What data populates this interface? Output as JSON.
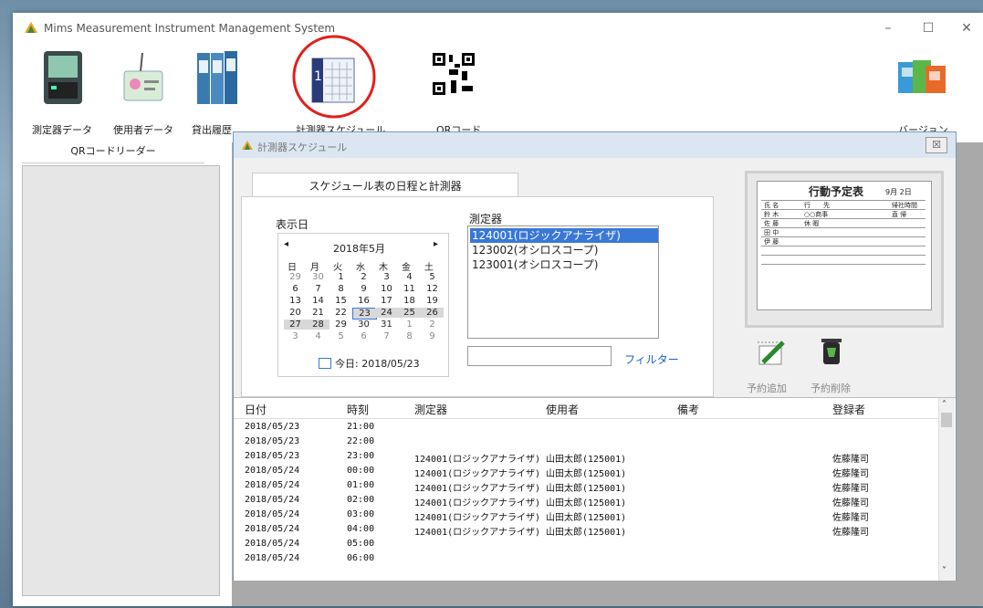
{
  "window": {
    "title": "Mims  Measurement Instrument Management System",
    "minimize": "–",
    "maximize": "☐",
    "close": "✕"
  },
  "toolbar": {
    "items": [
      {
        "label": "測定器データ"
      },
      {
        "label": "使用者データ"
      },
      {
        "label": "貸出履歴"
      },
      {
        "label": "計測器スケジュール"
      },
      {
        "label": "QRコード"
      },
      {
        "label": "バージョン"
      }
    ]
  },
  "left_panel": {
    "tab": "QRコードリーダー"
  },
  "dialog": {
    "title": "計測器スケジュール",
    "close": "☒",
    "tab": "スケジュール表の日程と計測器",
    "display_date_label": "表示日",
    "calendar": {
      "month": "2018年5月",
      "prev": "◂",
      "next": "▸",
      "weekdays": [
        "日",
        "月",
        "火",
        "水",
        "木",
        "金",
        "土"
      ],
      "weeks": [
        [
          "29",
          "30",
          "1",
          "2",
          "3",
          "4",
          "5"
        ],
        [
          "6",
          "7",
          "8",
          "9",
          "10",
          "11",
          "12"
        ],
        [
          "13",
          "14",
          "15",
          "16",
          "17",
          "18",
          "19"
        ],
        [
          "20",
          "21",
          "22",
          "23",
          "24",
          "25",
          "26"
        ],
        [
          "27",
          "28",
          "29",
          "30",
          "31",
          "1",
          "2"
        ],
        [
          "3",
          "4",
          "5",
          "6",
          "7",
          "8",
          "9"
        ]
      ],
      "today": "今日: 2018/05/23"
    },
    "instrument_label": "測定器",
    "instruments": [
      "124001(ロジックアナライザ)",
      "123002(オシロスコープ)",
      "123001(オシロスコープ)"
    ],
    "filter_label": "フィルター",
    "whiteboard": {
      "title": "行動予定表",
      "date": "9月 2日",
      "headers": [
        "氏 名",
        "行　　先",
        "帰社時間"
      ],
      "rows": [
        [
          "鈴 木",
          "○○商事",
          "直 帰"
        ],
        [
          "佐 藤",
          "休 暇",
          ""
        ],
        [
          "田 中",
          "",
          ""
        ],
        [
          "伊 藤",
          "",
          ""
        ]
      ]
    },
    "add_label": "予約追加",
    "delete_label": "予約削除",
    "grid": {
      "headers": [
        "日付",
        "時刻",
        "測定器",
        "使用者",
        "備考",
        "登録者"
      ],
      "rows": [
        [
          "2018/05/23",
          "21:00",
          "",
          "",
          "",
          ""
        ],
        [
          "2018/05/23",
          "22:00",
          "",
          "",
          "",
          ""
        ],
        [
          "2018/05/23",
          "23:00",
          "124001(ロジックアナライザ)",
          "山田太郎(125001)",
          "",
          "佐藤隆司"
        ],
        [
          "2018/05/24",
          "00:00",
          "124001(ロジックアナライザ)",
          "山田太郎(125001)",
          "",
          "佐藤隆司"
        ],
        [
          "2018/05/24",
          "01:00",
          "124001(ロジックアナライザ)",
          "山田太郎(125001)",
          "",
          "佐藤隆司"
        ],
        [
          "2018/05/24",
          "02:00",
          "124001(ロジックアナライザ)",
          "山田太郎(125001)",
          "",
          "佐藤隆司"
        ],
        [
          "2018/05/24",
          "03:00",
          "124001(ロジックアナライザ)",
          "山田太郎(125001)",
          "",
          "佐藤隆司"
        ],
        [
          "2018/05/24",
          "04:00",
          "124001(ロジックアナライザ)",
          "山田太郎(125001)",
          "",
          "佐藤隆司"
        ],
        [
          "2018/05/24",
          "05:00",
          "",
          "",
          "",
          ""
        ],
        [
          "2018/05/24",
          "06:00",
          "",
          "",
          "",
          ""
        ]
      ]
    }
  },
  "icons": {
    "app": "app-logo-icon"
  },
  "colors": {
    "highlight_circle": "#e0201c",
    "selection": "#3a78d8",
    "filter_link": "#1a5fd0"
  }
}
